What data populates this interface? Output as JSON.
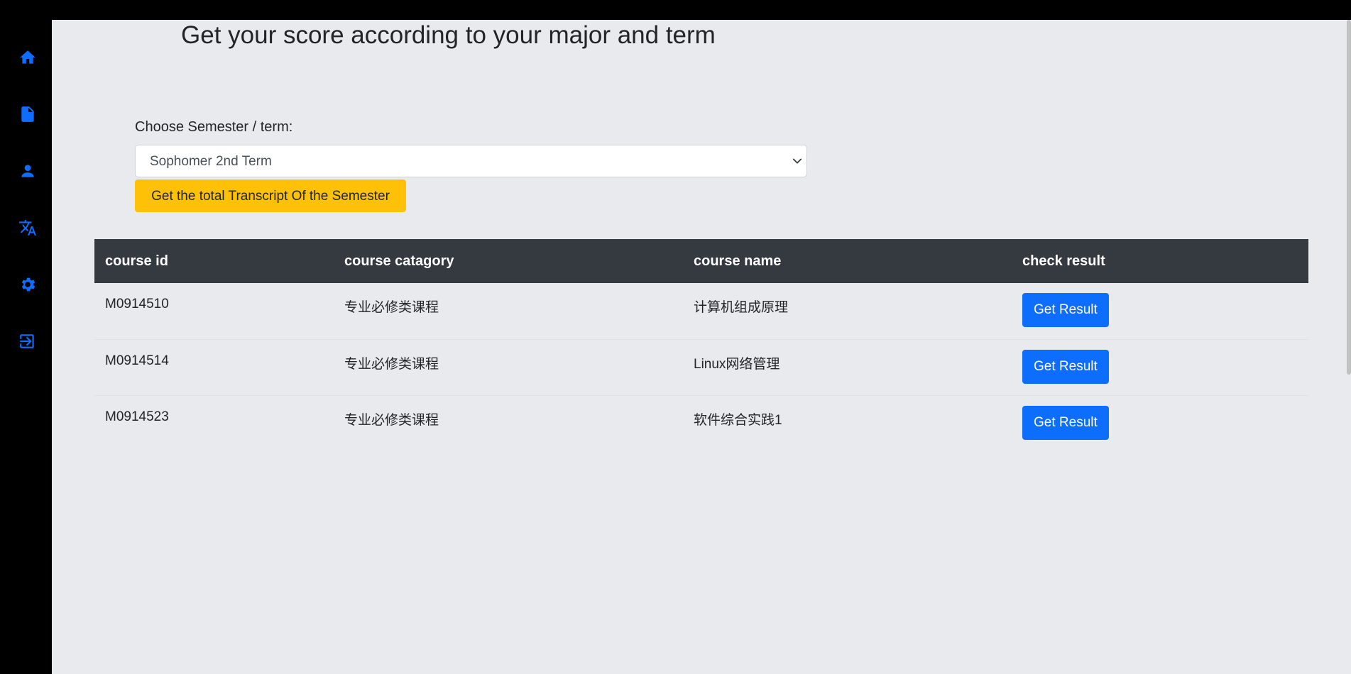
{
  "sidebar": {
    "items": [
      {
        "icon": "home-icon"
      },
      {
        "icon": "document-icon"
      },
      {
        "icon": "user-icon"
      },
      {
        "icon": "translate-icon"
      },
      {
        "icon": "gear-icon"
      },
      {
        "icon": "logout-icon"
      }
    ],
    "icon_color": "#0d6efd"
  },
  "header": {
    "title": "Get your score according to your major and term"
  },
  "form": {
    "label": "Choose Semester / term:",
    "selected_value": "Sophomer 2nd Term",
    "submit_label": "Get the total Transcript Of the Semester"
  },
  "table": {
    "headers": [
      "course id",
      "course catagory",
      "course name",
      "check result"
    ],
    "rows": [
      {
        "course_id": "M0914510",
        "category": "专业必修类课程",
        "name": "计算机组成原理",
        "action": "Get Result"
      },
      {
        "course_id": "M0914514",
        "category": "专业必修类课程",
        "name": "Linux网络管理",
        "action": "Get Result"
      },
      {
        "course_id": "M0914523",
        "category": "专业必修类课程",
        "name": "软件综合实践1",
        "action": "Get Result"
      }
    ]
  },
  "colors": {
    "accent": "#0d6efd",
    "warning": "#ffc107",
    "table_header": "#343a40",
    "background": "#e9eaed"
  }
}
